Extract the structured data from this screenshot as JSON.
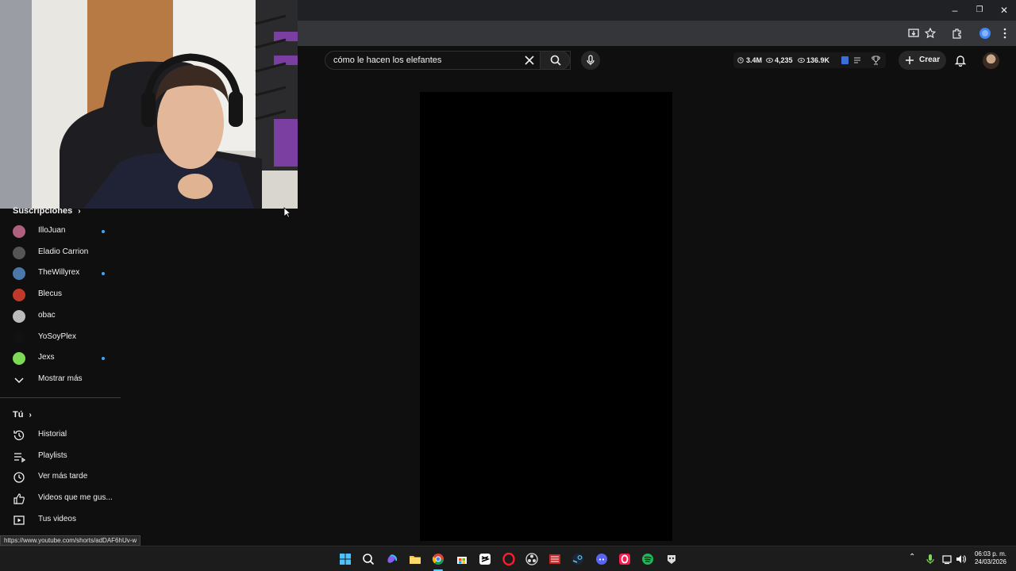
{
  "browser": {
    "window_controls": {
      "minimize": "–",
      "restore": "❐",
      "close": "✕"
    },
    "toolbar_icons": [
      "install-icon",
      "bookmark-star-icon",
      "extensions-icon",
      "profile-icon",
      "menu-icon"
    ]
  },
  "youtube": {
    "search": {
      "query": "cómo le hacen los elefantes"
    },
    "stats": {
      "views": "3.4M",
      "watching": "4,235",
      "subs": "136.9K"
    },
    "create_label": "Crear"
  },
  "sidebar": {
    "subscriptions_title": "Suscripciones",
    "subscriptions": [
      {
        "label": "IlloJuan",
        "dot": true,
        "color": "#b0607f"
      },
      {
        "label": "Eladio Carrion",
        "dot": false,
        "color": "#555555"
      },
      {
        "label": "TheWillyrex",
        "dot": true,
        "color": "#4a78a8"
      },
      {
        "label": "Blecus",
        "dot": false,
        "color": "#c0392b"
      },
      {
        "label": "obac",
        "dot": false,
        "color": "#bbbbbb"
      },
      {
        "label": "YoSoyPlex",
        "dot": false,
        "color": "#111111"
      },
      {
        "label": "Jexs",
        "dot": true,
        "color": "#7ed957"
      }
    ],
    "show_more": "Mostrar más",
    "you_title": "Tú",
    "you_items": [
      {
        "label": "Historial",
        "icon": "history-icon"
      },
      {
        "label": "Playlists",
        "icon": "playlists-icon"
      },
      {
        "label": "Ver más tarde",
        "icon": "watch-later-icon"
      },
      {
        "label": "Videos que me gus...",
        "icon": "like-icon"
      },
      {
        "label": "Tus videos",
        "icon": "your-videos-icon"
      }
    ]
  },
  "status_bar": {
    "url": "https://www.youtube.com/shorts/adDAF6hUv-w"
  },
  "taskbar": {
    "time": "06:03 p. m.",
    "date": "24/03/2026",
    "apps": [
      "windows-start-icon",
      "search-icon",
      "copilot-icon",
      "file-explorer-icon",
      "chrome-icon",
      "store-icon",
      "capcut-icon",
      "opera-icon",
      "obs-icon",
      "media-icon",
      "steam-icon",
      "discord-icon",
      "opera-gx-icon",
      "spotify-icon",
      "app-icon"
    ]
  },
  "colors": {
    "background": "#0f0f0f",
    "accent_dot": "#3ea6ff"
  }
}
